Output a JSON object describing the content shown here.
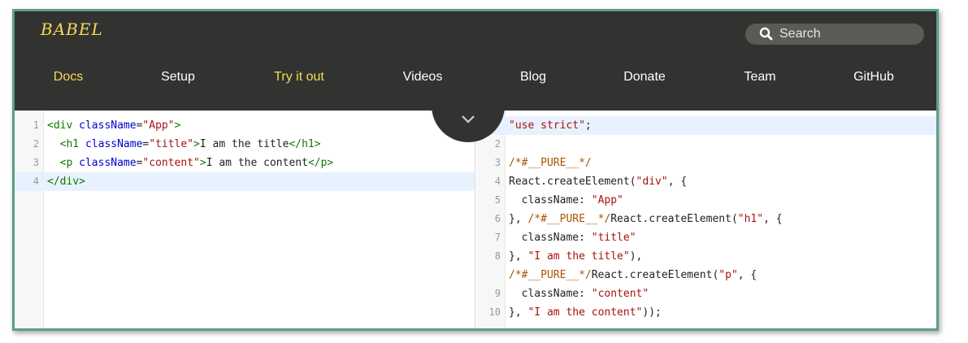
{
  "app": {
    "logo": "BABEL"
  },
  "search": {
    "placeholder": "Search"
  },
  "nav": [
    {
      "label": "Docs",
      "active": true
    },
    {
      "label": "Setup",
      "active": false
    },
    {
      "label": "Try it out",
      "active": true
    },
    {
      "label": "Videos",
      "active": false
    },
    {
      "label": "Blog",
      "active": false
    },
    {
      "label": "Donate",
      "active": false
    },
    {
      "label": "Team",
      "active": false
    },
    {
      "label": "GitHub",
      "active": false
    }
  ],
  "colors": {
    "brand_yellow": "#f5da55",
    "header_bg": "#323330",
    "frame_border": "#5a9e8a",
    "highlight_line": "#e8f2fe"
  },
  "input_editor": {
    "lines": [
      {
        "num": "1",
        "tokens": [
          {
            "t": "<div ",
            "c": "tag"
          },
          {
            "t": "className",
            "c": "attr"
          },
          {
            "t": "=",
            "c": "plain"
          },
          {
            "t": "\"App\"",
            "c": "str"
          },
          {
            "t": ">",
            "c": "tag"
          }
        ]
      },
      {
        "num": "2",
        "tokens": [
          {
            "t": "  <h1 ",
            "c": "tag"
          },
          {
            "t": "className",
            "c": "attr"
          },
          {
            "t": "=",
            "c": "plain"
          },
          {
            "t": "\"title\"",
            "c": "str"
          },
          {
            "t": ">",
            "c": "tag"
          },
          {
            "t": "I am the title",
            "c": "plain"
          },
          {
            "t": "</h1>",
            "c": "tag"
          }
        ]
      },
      {
        "num": "3",
        "tokens": [
          {
            "t": "  <p ",
            "c": "tag"
          },
          {
            "t": "className",
            "c": "attr"
          },
          {
            "t": "=",
            "c": "plain"
          },
          {
            "t": "\"content\"",
            "c": "str"
          },
          {
            "t": ">",
            "c": "tag"
          },
          {
            "t": "I am the content",
            "c": "plain"
          },
          {
            "t": "</p>",
            "c": "tag"
          }
        ]
      },
      {
        "num": "4",
        "highlight": true,
        "tokens": [
          {
            "t": "</div>",
            "c": "tag"
          }
        ]
      }
    ]
  },
  "output_editor": {
    "lines": [
      {
        "num": "",
        "highlight": true,
        "tokens": [
          {
            "t": "\"use strict\"",
            "c": "str"
          },
          {
            "t": ";",
            "c": "plain"
          }
        ]
      },
      {
        "num": "2",
        "tokens": []
      },
      {
        "num": "3",
        "tokens": [
          {
            "t": "/*#__PURE__*/",
            "c": "cmt"
          }
        ]
      },
      {
        "num": "4",
        "tokens": [
          {
            "t": "React.createElement(",
            "c": "plain"
          },
          {
            "t": "\"div\"",
            "c": "str"
          },
          {
            "t": ", {",
            "c": "plain"
          }
        ]
      },
      {
        "num": "5",
        "tokens": [
          {
            "t": "  className: ",
            "c": "plain"
          },
          {
            "t": "\"App\"",
            "c": "str"
          }
        ]
      },
      {
        "num": "6",
        "tokens": [
          {
            "t": "}, ",
            "c": "plain"
          },
          {
            "t": "/*#__PURE__*/",
            "c": "cmt"
          },
          {
            "t": "React.createElement(",
            "c": "plain"
          },
          {
            "t": "\"h1\"",
            "c": "str"
          },
          {
            "t": ", {",
            "c": "plain"
          }
        ]
      },
      {
        "num": "7",
        "tokens": [
          {
            "t": "  className: ",
            "c": "plain"
          },
          {
            "t": "\"title\"",
            "c": "str"
          }
        ]
      },
      {
        "num": "8",
        "tokens": [
          {
            "t": "}, ",
            "c": "plain"
          },
          {
            "t": "\"I am the title\"",
            "c": "str"
          },
          {
            "t": "),",
            "c": "plain"
          }
        ]
      },
      {
        "num": "",
        "tokens": [
          {
            "t": "/*#__PURE__*/",
            "c": "cmt"
          },
          {
            "t": "React.createElement(",
            "c": "plain"
          },
          {
            "t": "\"p\"",
            "c": "str"
          },
          {
            "t": ", {",
            "c": "plain"
          }
        ]
      },
      {
        "num": "9",
        "tokens": [
          {
            "t": "  className: ",
            "c": "plain"
          },
          {
            "t": "\"content\"",
            "c": "str"
          }
        ]
      },
      {
        "num": "10",
        "tokens": [
          {
            "t": "}, ",
            "c": "plain"
          },
          {
            "t": "\"I am the content\"",
            "c": "str"
          },
          {
            "t": "));",
            "c": "plain"
          }
        ]
      }
    ]
  }
}
